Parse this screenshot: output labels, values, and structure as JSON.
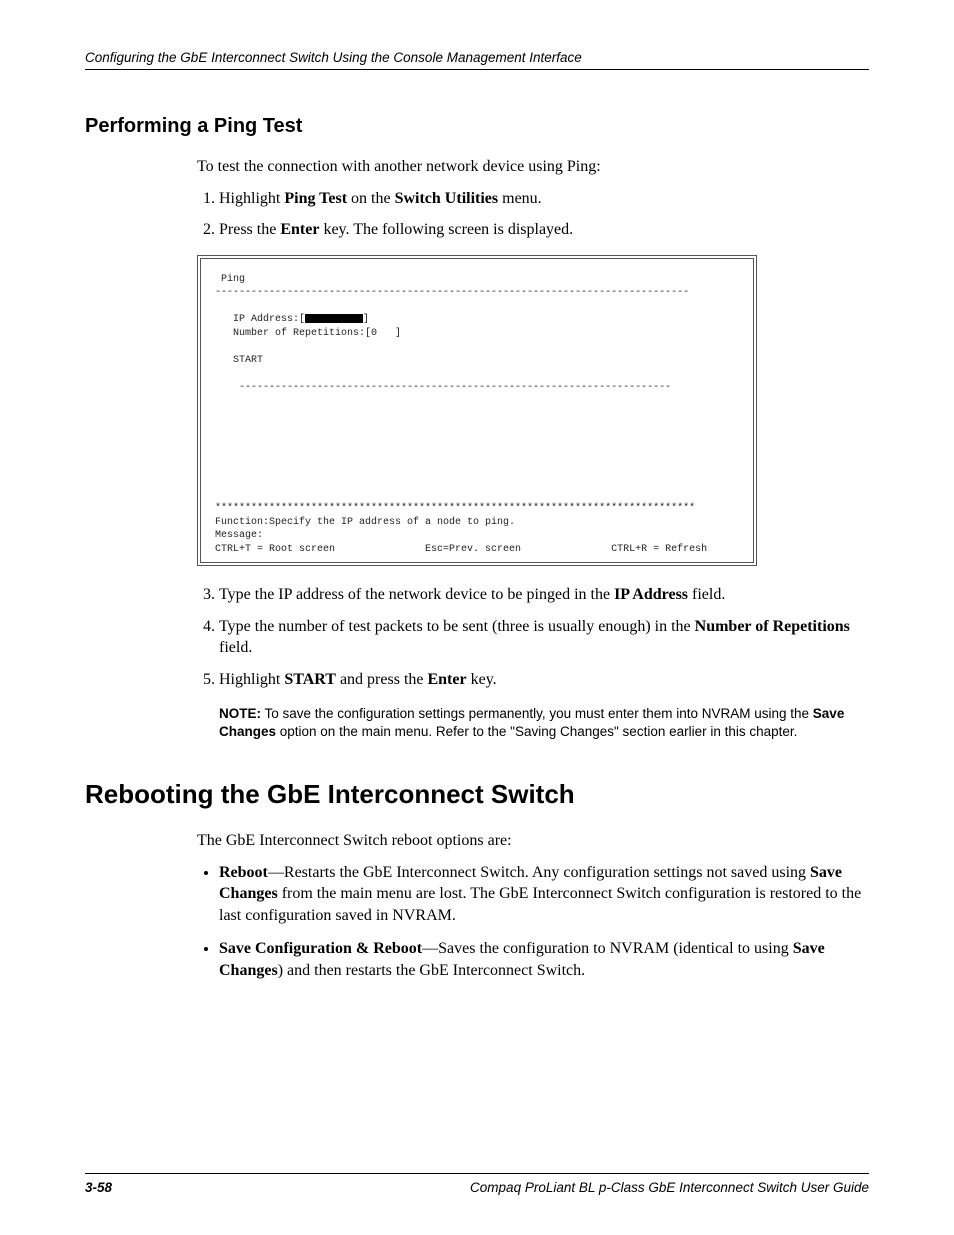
{
  "header": {
    "running": "Configuring the GbE Interconnect Switch Using the Console Management Interface"
  },
  "section1": {
    "title": "Performing a Ping Test",
    "intro": "To test the connection with another network device using Ping:",
    "step1_a": "Highlight ",
    "step1_b": "Ping Test",
    "step1_c": " on the ",
    "step1_d": "Switch Utilities",
    "step1_e": " menu.",
    "step2_a": "Press the ",
    "step2_b": "Enter",
    "step2_c": " key. The following screen is displayed.",
    "step3_a": "Type the IP address of the network device to be pinged in the ",
    "step3_b": "IP Address",
    "step3_c": " field.",
    "step4_a": "Type the number of test packets to be sent (three is usually enough) in the ",
    "step4_b": "Number of Repetitions",
    "step4_c": " field.",
    "step5_a": "Highlight ",
    "step5_b": "START",
    "step5_c": " and press the ",
    "step5_d": "Enter",
    "step5_e": " key.",
    "note_label": "NOTE:",
    "note_body": "  To save the configuration settings permanently, you must enter them into NVRAM using the ",
    "note_bold": "Save Changes",
    "note_body2": " option on the main menu. Refer to the \"Saving Changes\" section earlier in this chapter."
  },
  "terminal": {
    "title": "  Ping",
    "dash1": " -------------------------------------------------------------------------------",
    "ip_label": "    IP Address:[",
    "ip_close": "]",
    "rep_line": "    Number of Repetitions:[0   ]",
    "start": "    START",
    "dash2": "     ------------------------------------------------------------------------",
    "stars": " ********************************************************************************",
    "func": " Function:Specify the IP address of a node to ping.",
    "msg": " Message:",
    "help_l": " CTRL+T = Root screen",
    "help_m": "Esc=Prev. screen",
    "help_r": "CTRL+R = Refresh"
  },
  "section2": {
    "title": "Rebooting the GbE Interconnect Switch",
    "intro": "The GbE Interconnect Switch reboot options are:",
    "b1_a": "Reboot",
    "b1_b": "—Restarts the GbE Interconnect Switch. Any configuration settings not saved using ",
    "b1_c": "Save Changes",
    "b1_d": " from the main menu are lost. The GbE Interconnect Switch configuration is restored to the last configuration saved in NVRAM.",
    "b2_a": "Save Configuration & Reboot",
    "b2_b": "—Saves the configuration to NVRAM (identical to using ",
    "b2_c": "Save Changes",
    "b2_d": ") and then restarts the GbE Interconnect Switch."
  },
  "footer": {
    "page": "3-58",
    "book": "Compaq ProLiant BL p-Class GbE Interconnect Switch User Guide"
  }
}
